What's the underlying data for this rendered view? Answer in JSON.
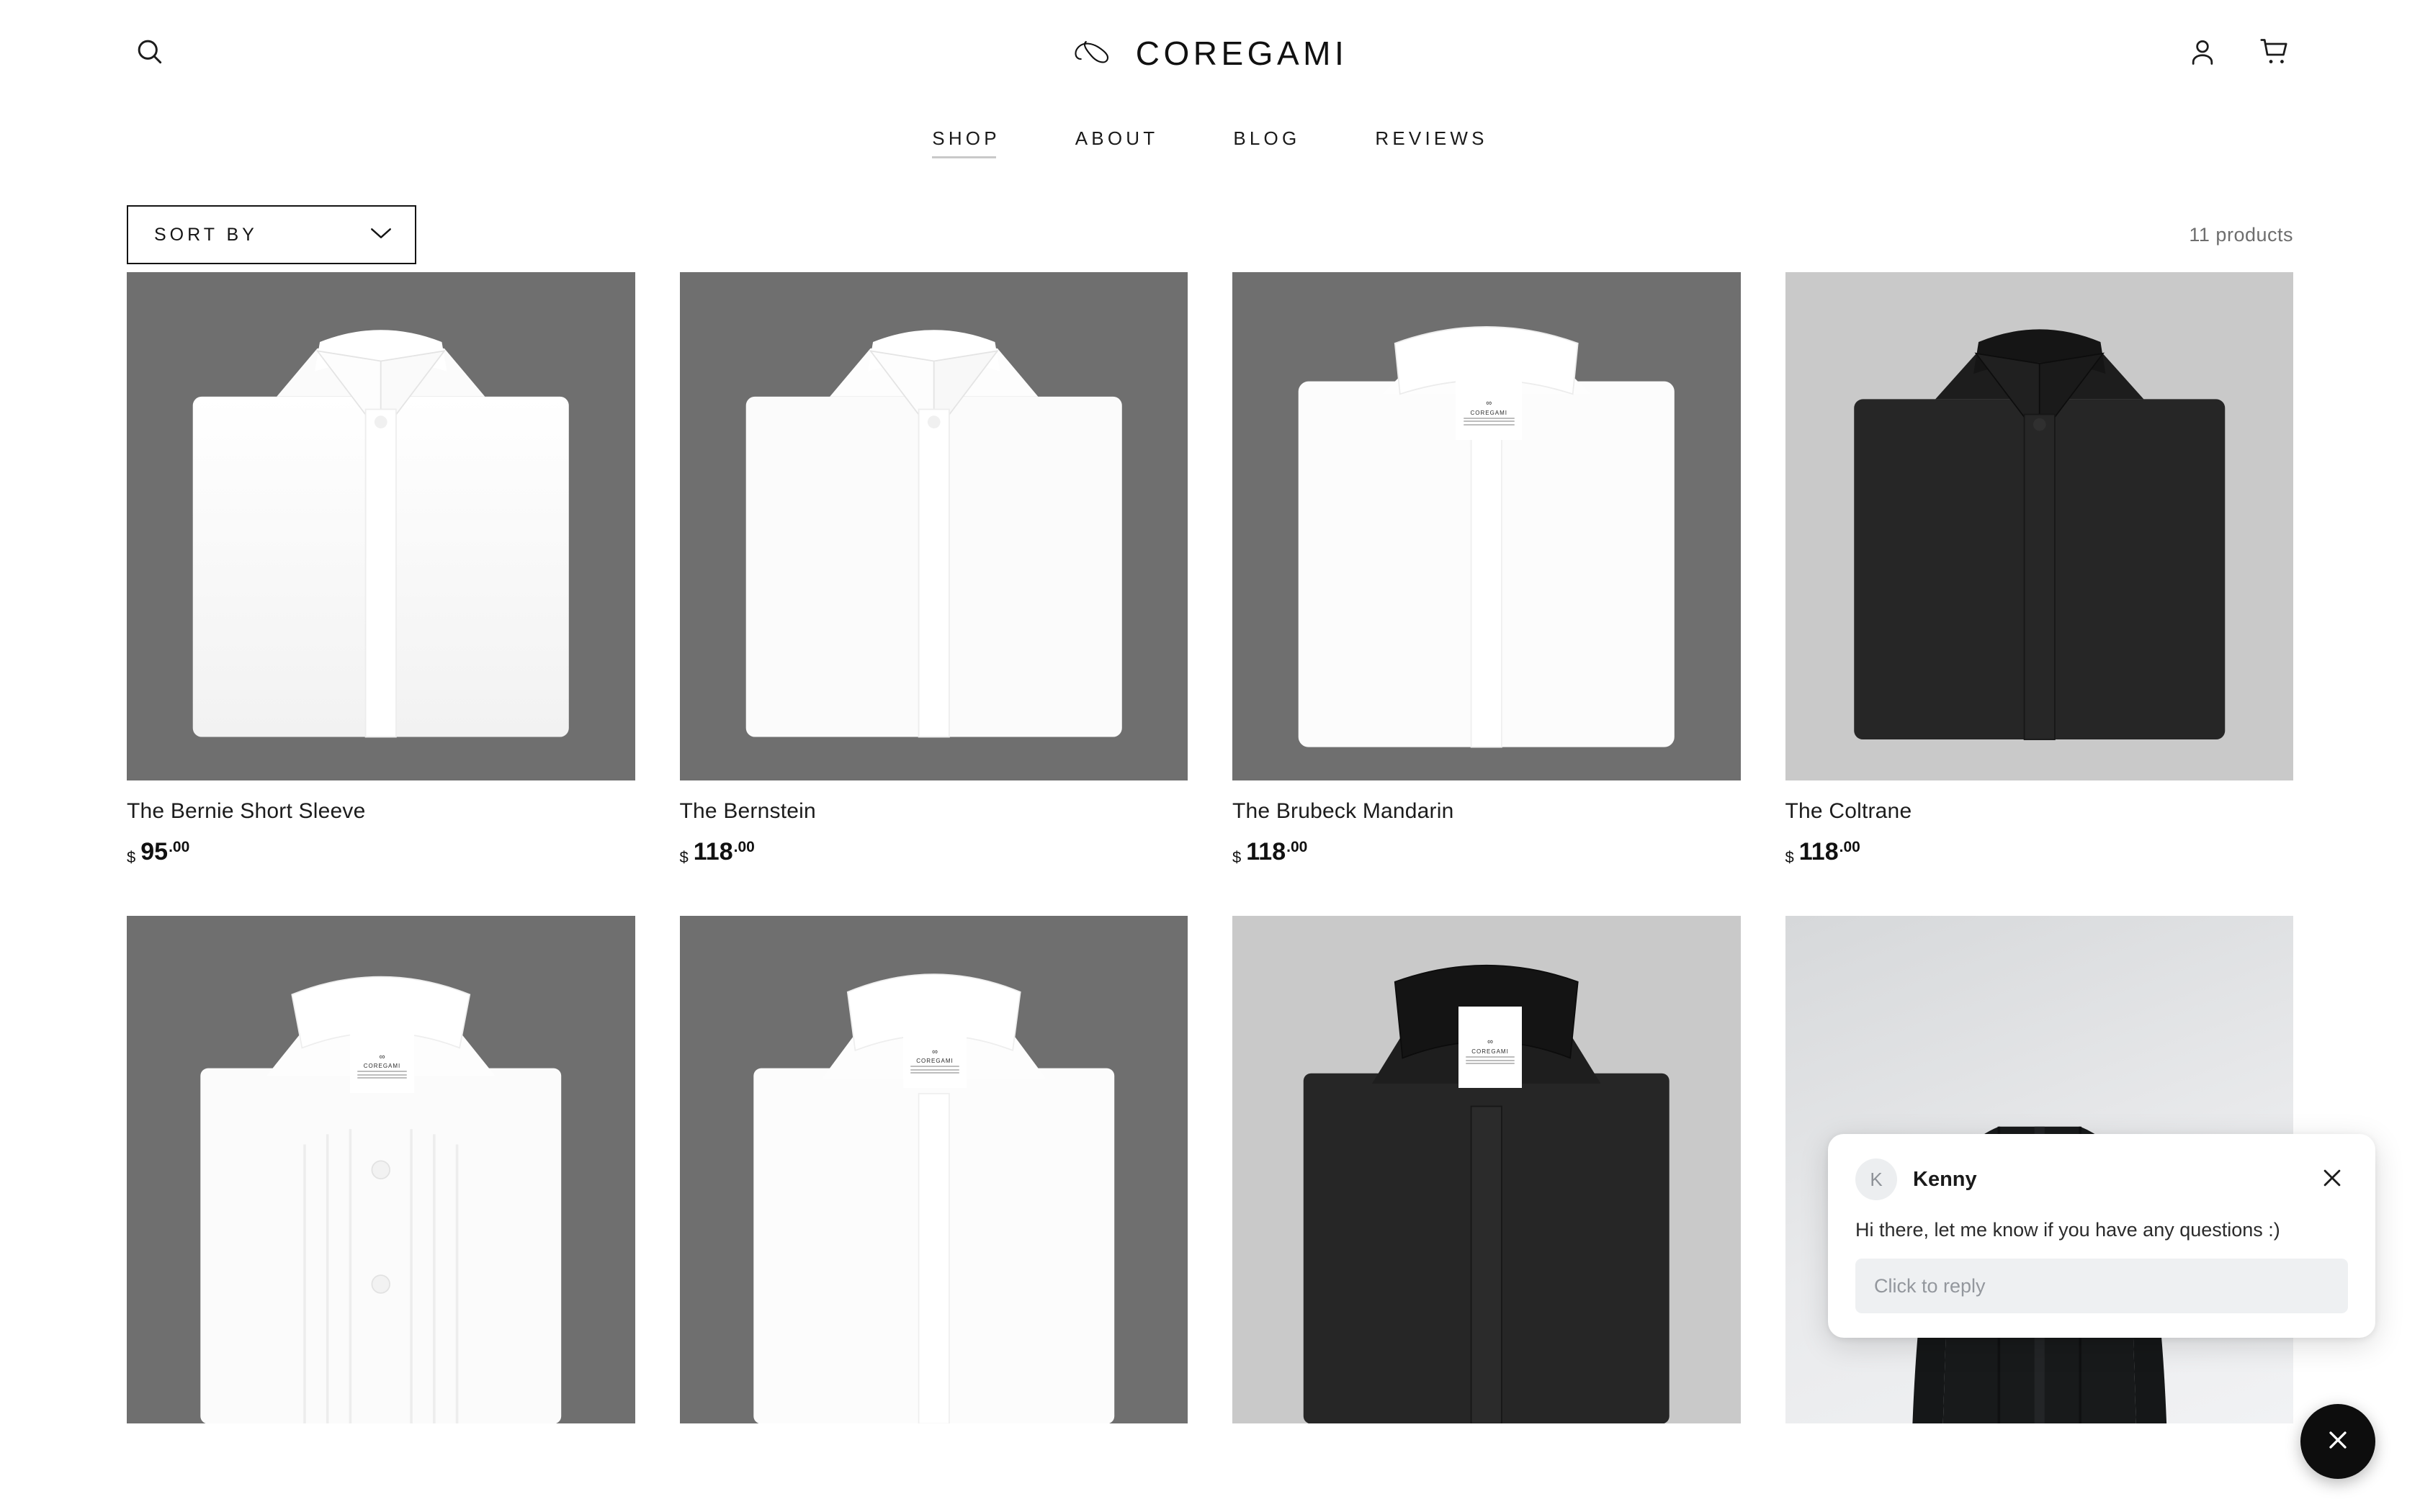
{
  "header": {
    "search_icon": "search-icon",
    "brand_name": "COREGAMI",
    "brand_mark": "infinity-mark",
    "account_icon": "user-icon",
    "cart_icon": "shopping-cart-icon"
  },
  "nav": {
    "items": [
      {
        "label": "SHOP",
        "active": true
      },
      {
        "label": "ABOUT",
        "active": false
      },
      {
        "label": "BLOG",
        "active": false
      },
      {
        "label": "REVIEWS",
        "active": false
      }
    ]
  },
  "toolbar": {
    "sort_label": "SORT BY",
    "sort_chevron_icon": "chevron-down-icon",
    "product_count": "11 products"
  },
  "products": [
    {
      "title": "The Bernie Short Sleeve",
      "currency": "$",
      "amount": "95",
      "cents": ".00",
      "bg": "dark",
      "style": "point-collar",
      "has_tag": false
    },
    {
      "title": "The Bernstein",
      "currency": "$",
      "amount": "118",
      "cents": ".00",
      "bg": "dark",
      "style": "point-collar",
      "has_tag": false
    },
    {
      "title": "The Brubeck Mandarin",
      "currency": "$",
      "amount": "118",
      "cents": ".00",
      "bg": "dark",
      "style": "mandarin-white",
      "has_tag": true
    },
    {
      "title": "The Coltrane",
      "currency": "$",
      "amount": "118",
      "cents": ".00",
      "bg": "light",
      "style": "point-collar-black",
      "has_tag": false
    }
  ],
  "products_row2": [
    {
      "bg": "dark",
      "style": "tuxedo-pleated",
      "has_tag": true
    },
    {
      "bg": "dark",
      "style": "mandarin-white2",
      "has_tag": true
    },
    {
      "bg": "light",
      "style": "mandarin-black",
      "has_tag": true
    },
    {
      "bg": "verylight",
      "style": "model-black",
      "has_tag": false
    }
  ],
  "tag": {
    "mark": "∞",
    "name": "COREGAMI"
  },
  "chat": {
    "avatar_initial": "K",
    "agent_name": "Kenny",
    "message": "Hi there, let me know if you have any questions :)",
    "reply_placeholder": "Click to reply",
    "close_icon": "close-icon"
  },
  "fab": {
    "icon": "close-icon"
  },
  "colors": {
    "accent": "#000000",
    "muted_text": "#6e6e6e",
    "image_bg_dark": "#6f6f6f",
    "image_bg_light": "#c9c9c9"
  }
}
